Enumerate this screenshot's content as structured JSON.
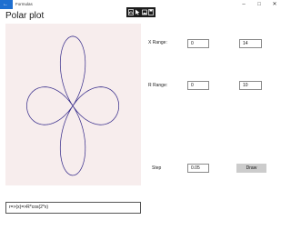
{
  "window": {
    "title": "Formulas",
    "icon": "back-arrow-icon",
    "controls": [
      "minimize-icon",
      "maximize-icon",
      "close-icon"
    ]
  },
  "page": {
    "title": "Polar plot"
  },
  "toolbar": {
    "icons": [
      "chart-icon",
      "cursor-icon",
      "image-icon",
      "save-icon"
    ]
  },
  "plot": {
    "background": "#f7eded",
    "curve_color": "#3a2f8c",
    "formula": "r=cos(2*theta)",
    "theta_range": [
      0,
      14
    ],
    "r_range": [
      0,
      10
    ],
    "step": 0.05
  },
  "controls": {
    "x_range_label": "X Range:",
    "x_min": "0",
    "x_max": "14",
    "r_range_label": "R Range:",
    "r_min": "0",
    "r_max": "10",
    "step_label": "Step",
    "step": "0.05",
    "draw_label": "Draw"
  },
  "formula_input": {
    "value": "r=>(x)=>R*cos(2*x)"
  }
}
